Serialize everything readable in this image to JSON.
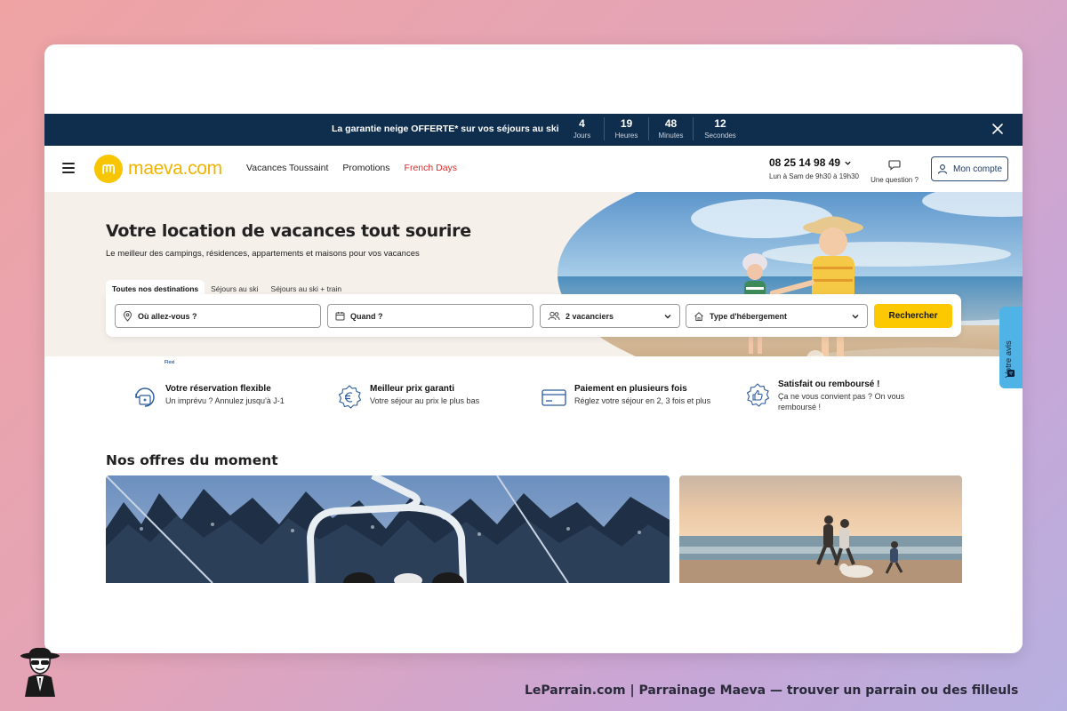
{
  "promo": {
    "text": "La garantie neige OFFERTE* sur vos séjours au ski",
    "countdown": [
      {
        "value": "4",
        "label": "Jours"
      },
      {
        "value": "19",
        "label": "Heures"
      },
      {
        "value": "48",
        "label": "Minutes"
      },
      {
        "value": "12",
        "label": "Secondes"
      }
    ],
    "close_icon": "close-icon"
  },
  "header": {
    "logo_text": "maeva.com",
    "nav": [
      "Vacances Toussaint",
      "Promotions",
      "French Days"
    ],
    "phone": "08 25 14 98 49",
    "hours": "Lun à Sam de 9h30 à 19h30",
    "question": "Une question ?",
    "account": "Mon compte"
  },
  "hero": {
    "title": "Votre location de vacances tout sourire",
    "subtitle": "Le meilleur des campings, résidences, appartements et maisons pour vos vacances",
    "tabs": [
      "Toutes nos destinations",
      "Séjours au ski",
      "Séjours au ski + train"
    ],
    "search": {
      "where": "Où allez-vous ?",
      "when": "Quand ?",
      "guests": "2 vacanciers",
      "type": "Type d'hébergement",
      "button": "Rechercher"
    }
  },
  "benefits": [
    {
      "title": "Votre réservation flexible",
      "text": "Un imprévu ? Annulez jusqu'à J-1",
      "icon": "flexible-calendar-icon",
      "badge": "Flexi"
    },
    {
      "title": "Meilleur prix garanti",
      "text": "Votre séjour au prix le plus bas",
      "icon": "euro-badge-icon"
    },
    {
      "title": "Paiement en plusieurs fois",
      "text": "Réglez votre séjour en 2, 3 fois et plus",
      "icon": "credit-card-icon"
    },
    {
      "title": "Satisfait ou remboursé !",
      "text": "Ça ne vous convient pas ? On vous remboursé !",
      "icon": "thumbs-up-badge-icon"
    }
  ],
  "offers": {
    "title": "Nos offres du moment"
  },
  "side_tab": "Votre avis",
  "caption": "LeParrain.com | Parrainage Maeva — trouver un parrain ou des filleuls",
  "colors": {
    "promo_bg": "#0f2d4d",
    "brand_yellow": "#fcc900",
    "logo_text": "#f0b400",
    "french_days": "#d92c2c",
    "account_blue": "#1d3c6b",
    "avis_blue": "#4fb3e6",
    "hero_bg": "#f6f0eb"
  }
}
